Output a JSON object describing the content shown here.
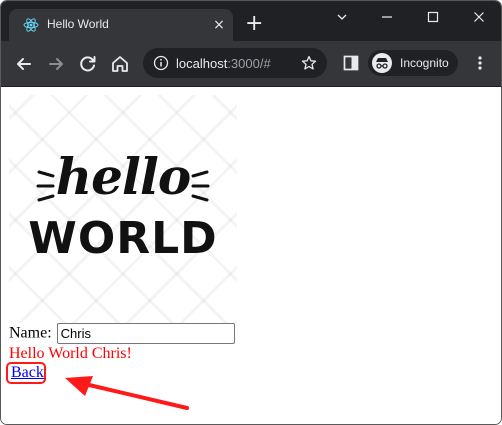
{
  "tab": {
    "title": "Hello World",
    "close_glyph": "×",
    "favicon": "react-icon"
  },
  "tabstrip": {
    "new_tab_glyph": "+"
  },
  "toolbar": {
    "url_host": "localhost",
    "url_rest": ":3000/#",
    "profile_label": "Incognito"
  },
  "page": {
    "hero_line1": "hello",
    "hero_line2": "WORLD",
    "name_label": "Name:",
    "name_value": "Chris",
    "greeting": "Hello World Chris!",
    "back_link": "Back"
  },
  "colors": {
    "greeting": "#ff0000",
    "link": "#0000ee",
    "annotation": "#ff1a1a",
    "chrome_dark": "#202124",
    "chrome_tab": "#35363a"
  }
}
